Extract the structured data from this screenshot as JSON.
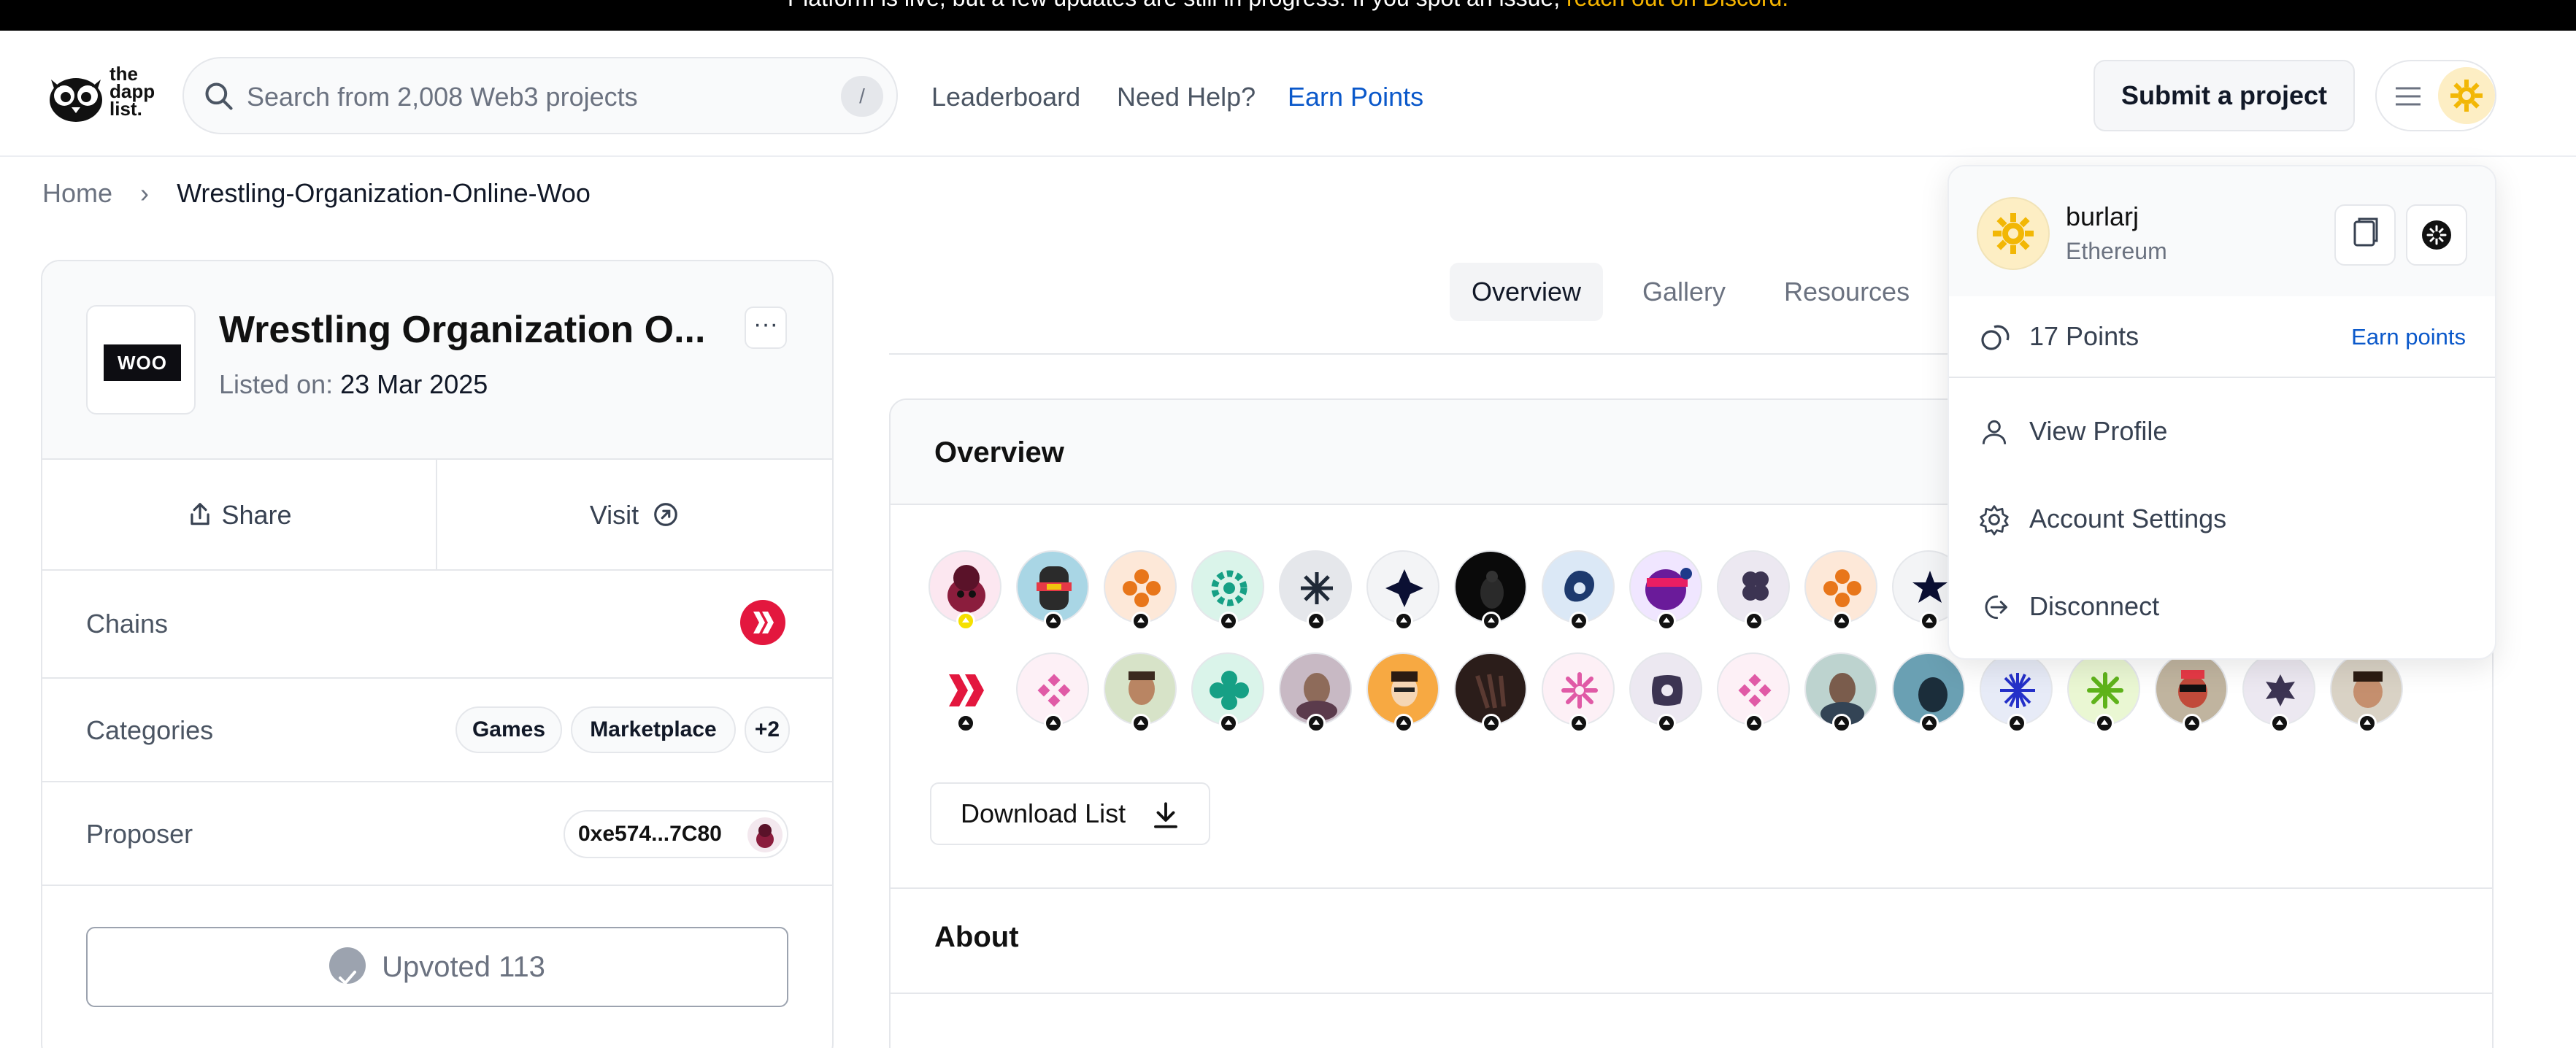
{
  "banner": {
    "text": "Platform is live, but a few updates are still in progress. If you spot an issue, ",
    "link": "reach out on Discord."
  },
  "header": {
    "logo_text_1": "the",
    "logo_text_2": "dapp",
    "logo_text_3": "list.",
    "search_placeholder": "Search from 2,008 Web3 projects",
    "search_shortcut": "/",
    "nav": [
      "Leaderboard",
      "Need Help?",
      "Earn Points"
    ],
    "submit_label": "Submit a project"
  },
  "breadcrumb": {
    "home": "Home",
    "current": "Wrestling-Organization-Online-Woo"
  },
  "project": {
    "logo_text": "WOO",
    "title": "Wrestling Organization O...",
    "listed_label": "Listed on:",
    "listed_date": "23 Mar 2025",
    "more": "···",
    "share": "Share",
    "visit": "Visit",
    "chains_label": "Chains",
    "categories_label": "Categories",
    "categories": [
      "Games",
      "Marketplace",
      "+2"
    ],
    "proposer_label": "Proposer",
    "proposer": "0xe574...7C80",
    "upvote_label": "Upvoted 113"
  },
  "tabs": [
    "Overview",
    "Gallery",
    "Resources"
  ],
  "overview": {
    "title": "Overview",
    "download_label": "Download List",
    "about_title": "About",
    "avatar_icons": [
      "avatar-1",
      "avatar-2",
      "avatar-3",
      "avatar-4",
      "avatar-5",
      "avatar-6",
      "avatar-7",
      "avatar-8",
      "avatar-9",
      "avatar-10",
      "avatar-11",
      "avatar-12",
      "avatar-13",
      "avatar-14",
      "avatar-15",
      "avatar-16",
      "avatar-17",
      "avatar-18",
      "avatar-19",
      "avatar-20",
      "avatar-21",
      "avatar-22",
      "avatar-23",
      "avatar-24",
      "avatar-25",
      "avatar-26",
      "avatar-27",
      "avatar-28",
      "avatar-29"
    ]
  },
  "dropdown": {
    "username": "burlarj",
    "network": "Ethereum",
    "points": "17 Points",
    "earn_points": "Earn points",
    "items": [
      "View Profile",
      "Account Settings",
      "Disconnect"
    ]
  },
  "colors": {
    "accent": "#0a58ca",
    "banner_link": "#f5b400",
    "chain_red": "#e3173e"
  }
}
